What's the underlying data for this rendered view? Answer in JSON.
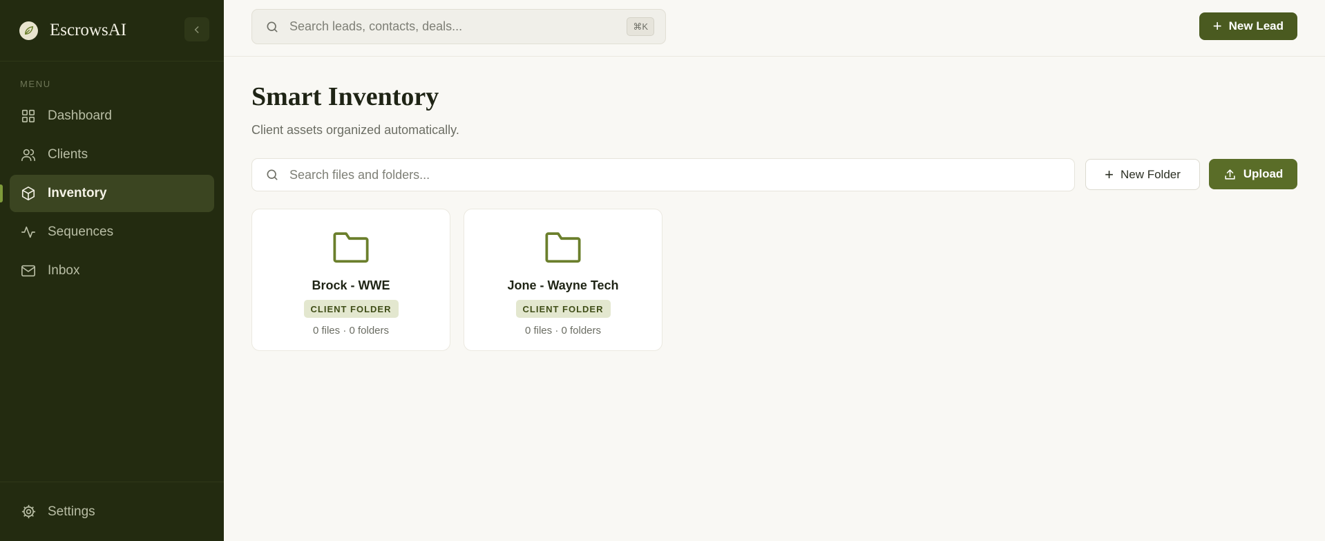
{
  "app": {
    "name": "EscrowsAI",
    "logo_icon": "leaf-logo-icon"
  },
  "sidebar": {
    "menu_label": "MENU",
    "items": [
      {
        "label": "Dashboard",
        "icon": "grid-icon",
        "active": false
      },
      {
        "label": "Clients",
        "icon": "users-icon",
        "active": false
      },
      {
        "label": "Inventory",
        "icon": "box-icon",
        "active": true
      },
      {
        "label": "Sequences",
        "icon": "activity-icon",
        "active": false
      },
      {
        "label": "Inbox",
        "icon": "mail-icon",
        "active": false
      }
    ],
    "settings_label": "Settings"
  },
  "topbar": {
    "search_placeholder": "Search leads, contacts, deals...",
    "shortcut": "⌘K",
    "new_lead_label": "New Lead"
  },
  "page": {
    "title": "Smart Inventory",
    "subtitle": "Client assets organized automatically.",
    "file_search_placeholder": "Search files and folders...",
    "new_folder_label": "New Folder",
    "upload_label": "Upload"
  },
  "folders": [
    {
      "name": "Brock - WWE",
      "badge": "CLIENT FOLDER",
      "meta": "0 files · 0 folders"
    },
    {
      "name": "Jone - Wayne Tech",
      "badge": "CLIENT FOLDER",
      "meta": "0 files · 0 folders"
    }
  ],
  "colors": {
    "sidebar_bg": "#232b10",
    "accent": "#4a5a20",
    "folder_icon": "#6b7f2c",
    "badge_bg": "#e3e7cf"
  }
}
